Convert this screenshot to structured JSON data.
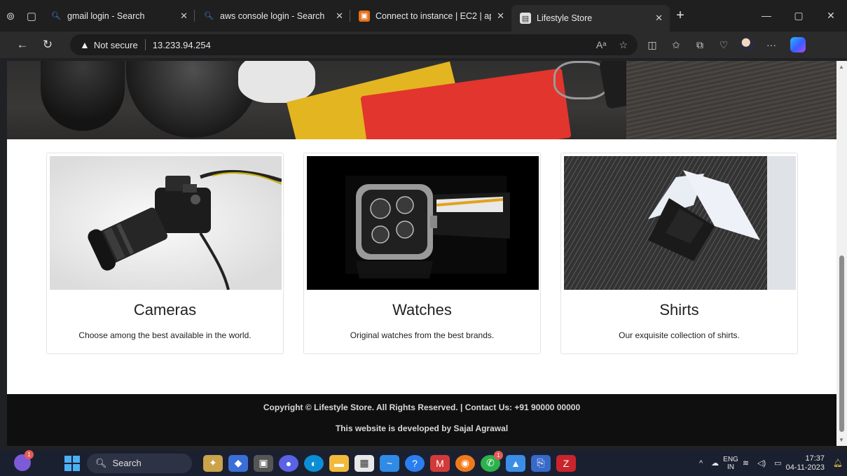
{
  "browser": {
    "tabs": [
      {
        "title": "gmail login - Search",
        "favicon": "search-icon",
        "active": false
      },
      {
        "title": "aws console login - Search",
        "favicon": "search-icon",
        "active": false
      },
      {
        "title": "Connect to instance | EC2 | ap-so",
        "favicon": "aws-icon",
        "active": false
      },
      {
        "title": "Lifestyle Store",
        "favicon": "page-icon",
        "active": true
      }
    ],
    "security_label": "Not secure",
    "url": "13.233.94.254"
  },
  "page": {
    "cards": [
      {
        "title": "Cameras",
        "description": "Choose among the best available in the world.",
        "image": "camera-image"
      },
      {
        "title": "Watches",
        "description": "Original watches from the best brands.",
        "image": "watch-image"
      },
      {
        "title": "Shirts",
        "description": "Our exquisite collection of shirts.",
        "image": "shirt-image"
      }
    ],
    "footer": {
      "copyright": "Copyright © Lifestyle Store. All Rights Reserved. | Contact Us: +91 90000 00000",
      "developer": "This website is developed by Sajal Agrawal"
    }
  },
  "taskbar": {
    "search_label": "Search",
    "notification_badge": "1",
    "whatsapp_badge": "1",
    "lang_top": "ENG",
    "lang_bottom": "IN",
    "time": "17:37",
    "date": "04-11-2023"
  }
}
